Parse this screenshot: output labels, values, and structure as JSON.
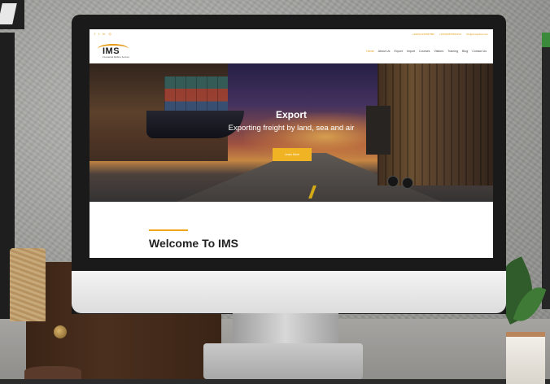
{
  "website": {
    "topbar": {
      "social_icons": [
        "facebook-icon",
        "twitter-icon",
        "linkedin-icon",
        "instagram-icon"
      ],
      "contacts": [
        "+234(0)1234567890",
        "+234(0)9876543210",
        "info@imsglobal.com"
      ]
    },
    "logo": {
      "text": "IMS",
      "tagline": "International Maritime Services"
    },
    "nav": {
      "items": [
        {
          "label": "Home",
          "active": true
        },
        {
          "label": "About Us",
          "active": false
        },
        {
          "label": "Export",
          "active": false
        },
        {
          "label": "Import",
          "active": false
        },
        {
          "label": "Courses",
          "active": false
        },
        {
          "label": "Visitors",
          "active": false
        },
        {
          "label": "Training",
          "active": false
        },
        {
          "label": "Blog",
          "active": false
        },
        {
          "label": "Contact Us",
          "active": false
        }
      ]
    },
    "hero": {
      "title": "Export",
      "subtitle": "Exporting freight by land, sea and air",
      "button_label": "Learn More"
    },
    "welcome": {
      "title": "Welcome To IMS"
    }
  },
  "colors": {
    "accent": "#f0b323",
    "nav_active": "#e39b16",
    "text_dark": "#222222"
  }
}
